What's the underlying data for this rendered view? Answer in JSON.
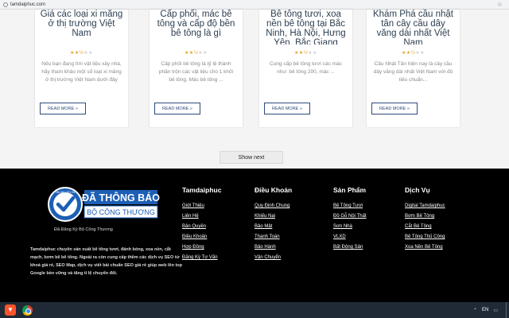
{
  "browser": {
    "url": "tamdaiphuc.com"
  },
  "cards": [
    {
      "title": "Giá các loại xi măng ở thị trường Việt Nam",
      "rating": 2.5,
      "desc": "Nếu bạn đang tìm vật liệu xây nhà, hãy tham khảo một số loại xi măng ở thị trường Việt Nam dưới đây",
      "more": "READ MORE »"
    },
    {
      "title": "Cấp phối, mác bê tông và cấp độ bền bê tông là gì",
      "rating": 2.5,
      "desc": "Cấp phối bê tông là tỷ lệ thành phần trộn các vật liệu cho 1 khối bê tông. Mác bê tông ...",
      "more": "READ MORE »"
    },
    {
      "title": "Bê tông tươi, xoa nền bê tông tại Bắc Ninh, Hà Nội, Hưng Yên, Bắc Giang",
      "rating": 2.5,
      "desc": "Cung cấp bê tông tươi các mác như: bê tông 200, mác ...",
      "more": "READ MORE »"
    },
    {
      "title": "Khám Phá cầu nhật tân cây cầu dây văng dài nhất Việt Nam",
      "rating": 2.5,
      "desc": "Cầu Nhật Tân hiện nay là cây cầu dây văng dài nhất Việt Nam với đủ tiêu chuẩn...",
      "more": "READ MORE »"
    }
  ],
  "show_next": "Show next",
  "footer": {
    "badge_line1": "ĐÃ THÔNG BÁO",
    "badge_line2": "BỘ CÔNG THƯƠNG",
    "badge_seal_text": "ONLINE.GOV.VN",
    "badge_caption": "Đã Đăng Ký Bộ Công Thương",
    "about": "Tamdaiphuc chuyên sản xuất bê tông tươi, đánh bóng, xoa nền, cắt mạch, bơm bê bê tông. Ngoài ra còn cung cấp thêm các dịch vụ SEO từ khoá giá rẻ, SEO Map, dịch vụ viết bài chuẩn SEO giá rẻ giúp web lên top Google bền vững và tăng tỉ lệ chuyển đổi.",
    "columns": [
      {
        "head": "Tamdaiphuc",
        "links": [
          "Giới Thiệu",
          "Liên Hệ",
          "Bản Quyền",
          "Điều Khoản",
          "Hợp Đồng",
          "Đăng Ký Tư Vấn"
        ]
      },
      {
        "head": "Điều Khoản",
        "links": [
          "Quy Định Chung",
          "Khiếu Nại",
          "Bảo Mật",
          "Thanh Toán",
          "Bảo Hành",
          "Vận Chuyển"
        ]
      },
      {
        "head": "Sản Phẩm",
        "links": [
          "Bê Tông Tươi",
          "Đồ Gỗ Nội Thất",
          "Sơn Nhà",
          "VLXD",
          "Bất Động Sản"
        ]
      },
      {
        "head": "Dịch Vụ",
        "links": [
          "Digital Tamdaiphuc",
          "Bơm Bê Tông",
          "Cắt Bê Tông",
          "Bê Tông Thủ Công",
          "Xoa Nền Bê Tông"
        ]
      }
    ]
  },
  "taskbar": {
    "language": "EN"
  },
  "colors": {
    "footer_bg": "#000000",
    "badge_blue": "#1d5fb5",
    "link_blue": "#2c4a7a",
    "star": "#e2a32a"
  }
}
